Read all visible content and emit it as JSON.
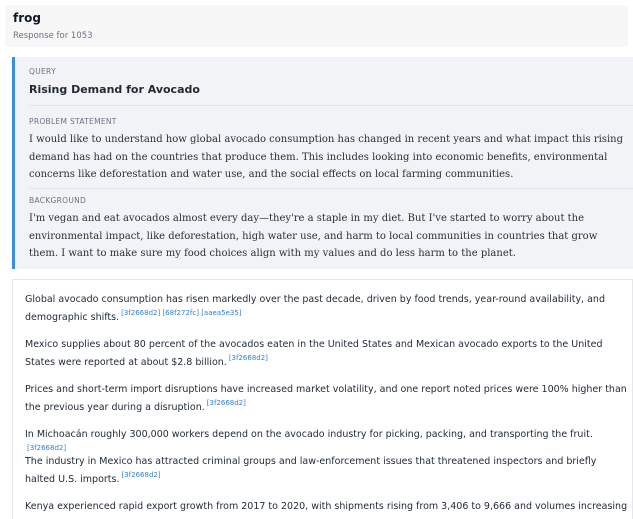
{
  "header": {
    "name": "frog",
    "subtitle": "Response for 1053"
  },
  "query": {
    "query_label": "QUERY",
    "title": "Rising Demand for Avocado",
    "problem_label": "PROBLEM STATEMENT",
    "problem_text": "I would like to understand how global avocado consumption has changed in recent years and what impact this rising demand has had on the countries that produce them. This includes looking into economic benefits, environmental concerns like deforestation and water use, and the social effects on local farming communities.",
    "background_label": "BACKGROUND",
    "background_text": "I'm vegan and eat avocados almost every day—they're a staple in my diet. But I've started to worry about the environmental impact, like deforestation, high water use, and harm to local communities in countries that grow them. I want to make sure my food choices align with my values and do less harm to the planet."
  },
  "answer": {
    "paragraphs": [
      {
        "text": "Global avocado consumption has risen markedly over the past decade, driven by food trends, year-round availability, and demographic shifts.",
        "cites": [
          "[3f2668d2]",
          "[68f272fc]",
          "[aaea5e35]"
        ]
      },
      {
        "text": "Mexico supplies about 80 percent of the avocados eaten in the United States and Mexican avocado exports to the United States were reported at about $2.8 billion.",
        "cites": [
          "[3f2668d2]"
        ]
      },
      {
        "text": "Prices and short-term import disruptions have increased market volatility, and one report noted prices were 100% higher than the previous year during a disruption.",
        "cites": [
          "[3f2668d2]"
        ]
      },
      {
        "text": "In Michoacán roughly 300,000 workers depend on the avocado industry for picking, packing, and transporting the fruit.",
        "cites": [
          "[3f2668d2]"
        ]
      },
      {
        "text": "The industry in Mexico has attracted criminal groups and law-enforcement issues that threatened inspectors and briefly halted U.S. imports.",
        "cites": [
          "[3f2668d2]"
        ]
      },
      {
        "text": "Kenya experienced rapid export growth from 2017 to 2020, with shipments rising from 3,406 to 9,666 and volumes increasing",
        "cites": []
      }
    ]
  }
}
